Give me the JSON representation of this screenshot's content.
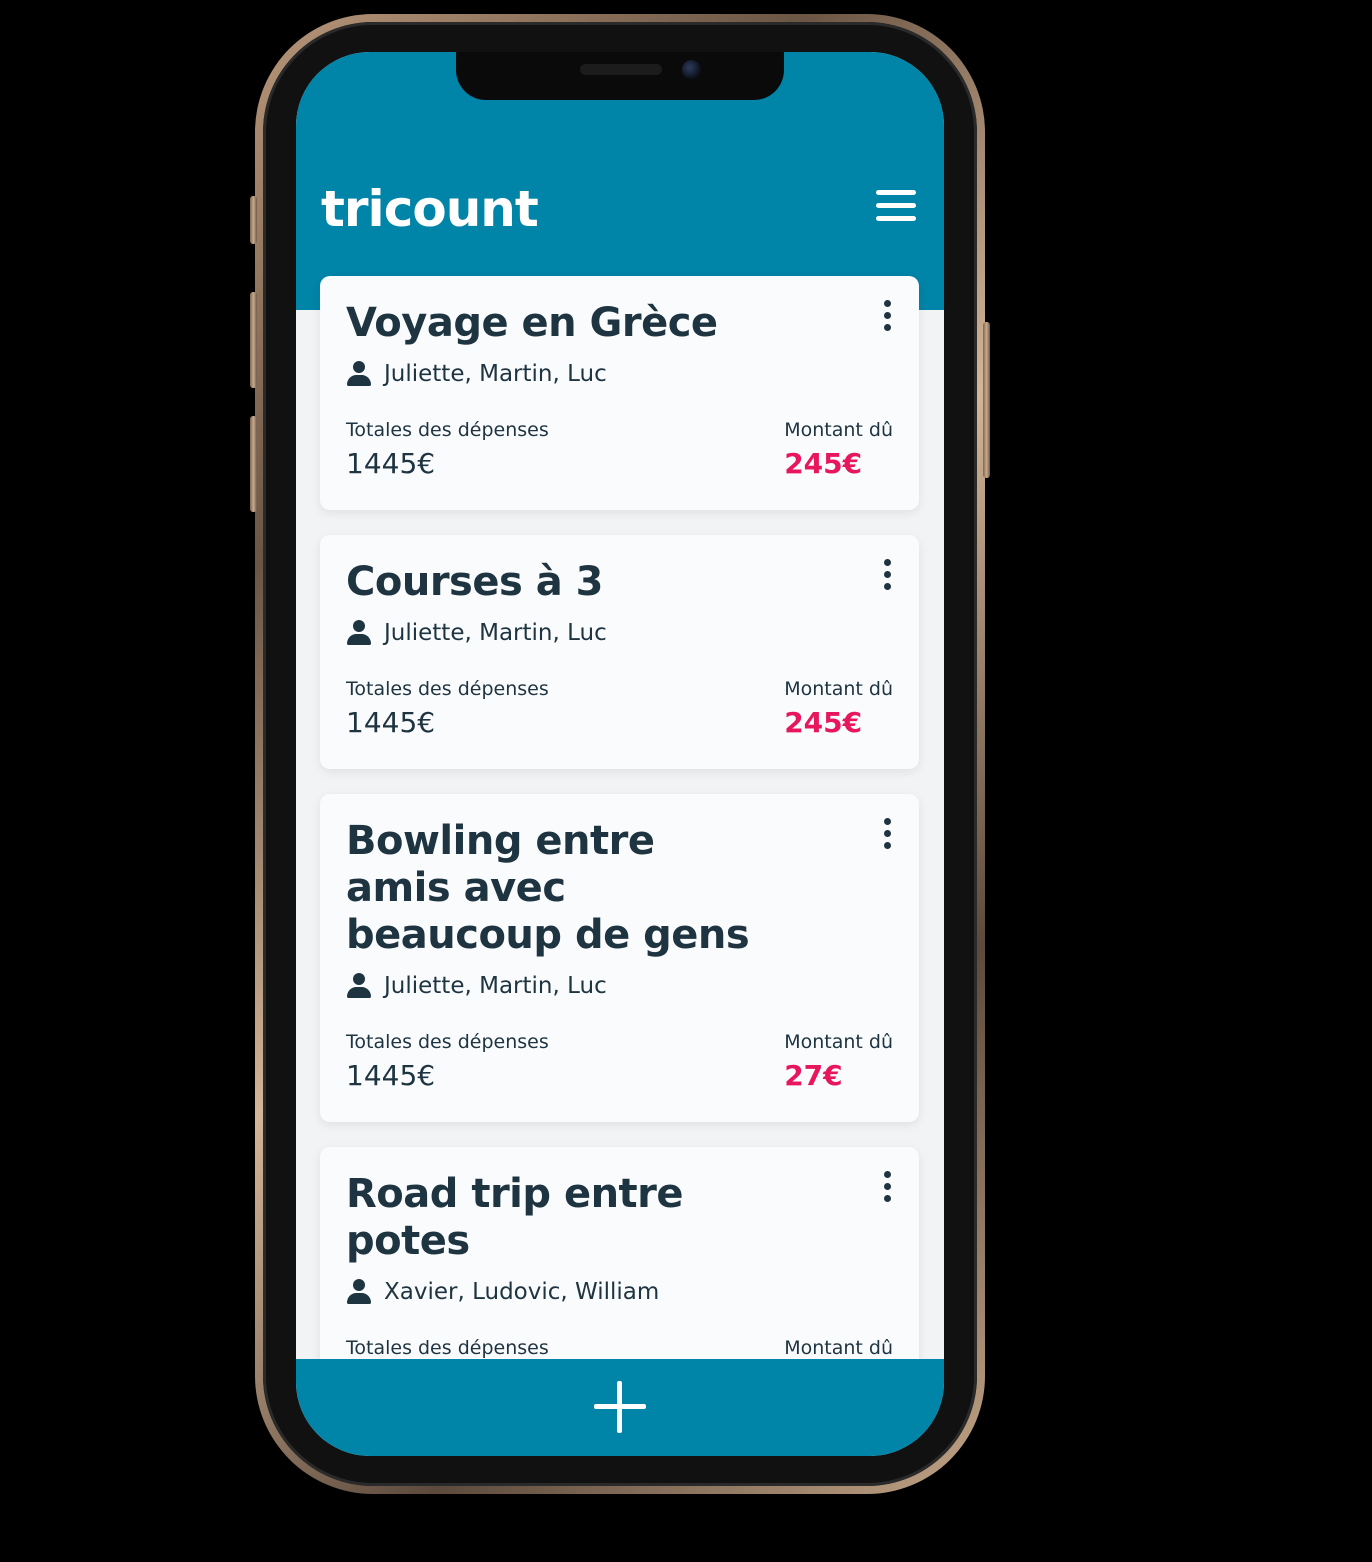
{
  "app": {
    "title": "tricount"
  },
  "cards": [
    {
      "title": "Voyage en Grèce",
      "members": "Juliette, Martin, Luc",
      "total_label": "Totales des dépenses",
      "total_value": "1445€",
      "due_label": "Montant dû",
      "due_value": "245€"
    },
    {
      "title": "Courses à 3",
      "members": "Juliette, Martin, Luc",
      "total_label": "Totales des dépenses",
      "total_value": "1445€",
      "due_label": "Montant dû",
      "due_value": "245€"
    },
    {
      "title": "Bowling entre amis avec beaucoup de gens",
      "members": "Juliette, Martin, Luc",
      "total_label": "Totales des dépenses",
      "total_value": "1445€",
      "due_label": "Montant dû",
      "due_value": "27€"
    },
    {
      "title": "Road trip entre potes",
      "members": "Xavier, Ludovic, William",
      "total_label": "Totales des dépenses",
      "total_value": "",
      "due_label": "Montant dû",
      "due_value": ""
    }
  ],
  "icons": {
    "menu": "hamburger-menu-icon",
    "more": "vertical-dots-icon",
    "person": "person-icon",
    "add": "plus-icon"
  },
  "colors": {
    "brand": "#0084a8",
    "due": "#e8175d",
    "text": "#1e3440"
  }
}
